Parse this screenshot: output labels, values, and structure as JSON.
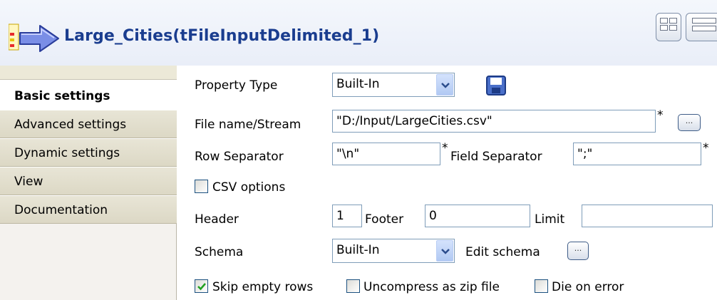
{
  "header": {
    "title": "Large_Cities(tFileInputDelimited_1)",
    "icon": "delimited-file-input-icon"
  },
  "sidebar": {
    "items": [
      {
        "label": "Basic settings",
        "active": true
      },
      {
        "label": "Advanced settings",
        "active": false
      },
      {
        "label": "Dynamic settings",
        "active": false
      },
      {
        "label": "View",
        "active": false
      },
      {
        "label": "Documentation",
        "active": false
      }
    ]
  },
  "form": {
    "property_type": {
      "label": "Property Type",
      "value": "Built-In"
    },
    "file_name": {
      "label": "File name/Stream",
      "value": "\"D:/Input/LargeCities.csv\"",
      "required": "*"
    },
    "row_separator": {
      "label": "Row Separator",
      "value": "\"\\n\"",
      "required": "*"
    },
    "field_separator": {
      "label": "Field Separator",
      "value": "\";\"",
      "required": "*"
    },
    "csv_options": {
      "label": "CSV options",
      "checked": false
    },
    "header": {
      "label": "Header",
      "value": "1"
    },
    "footer": {
      "label": "Footer",
      "value": "0"
    },
    "limit": {
      "label": "Limit",
      "value": ""
    },
    "schema": {
      "label": "Schema",
      "value": "Built-In"
    },
    "edit_schema": {
      "label": "Edit schema"
    },
    "skip_empty_rows": {
      "label": "Skip empty rows",
      "checked": true
    },
    "uncompress_zip": {
      "label": "Uncompress as zip file",
      "checked": false
    },
    "die_on_error": {
      "label": "Die on error",
      "checked": false
    },
    "ellipsis": "..."
  },
  "colors": {
    "title": "#1a3d8f",
    "field_border": "#7f9db9",
    "sidebar_bg": "#dcd8c5"
  }
}
